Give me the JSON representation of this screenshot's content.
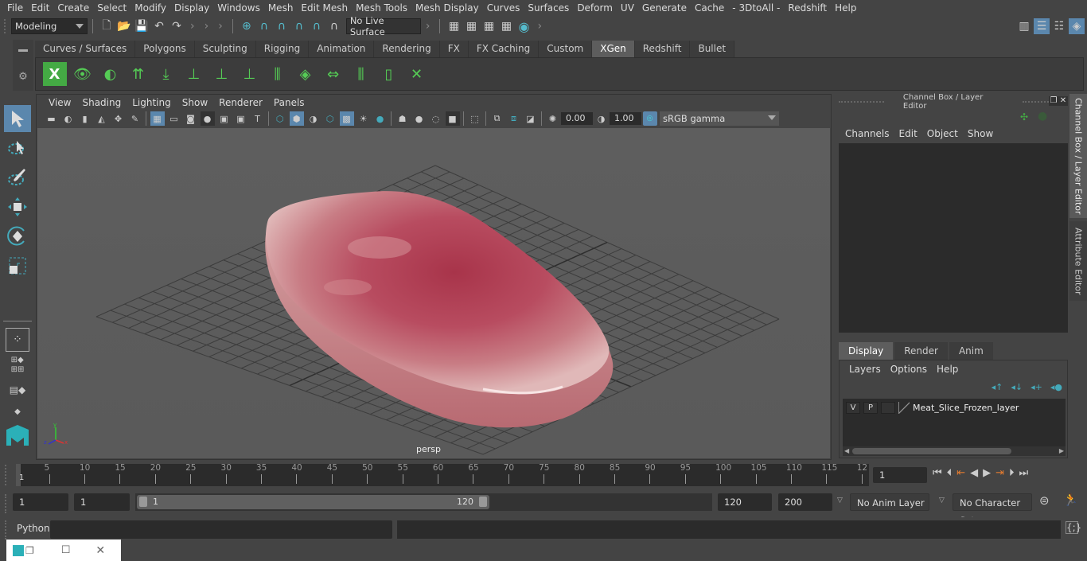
{
  "menubar": {
    "items": [
      "File",
      "Edit",
      "Create",
      "Select",
      "Modify",
      "Display",
      "Windows",
      "Mesh",
      "Edit Mesh",
      "Mesh Tools",
      "Mesh Display",
      "Curves",
      "Surfaces",
      "Deform",
      "UV",
      "Generate",
      "Cache",
      "- 3DtoAll -",
      "Redshift",
      "Help"
    ]
  },
  "statusline": {
    "mode": "Modeling",
    "live_surface": "No Live Surface"
  },
  "shelf": {
    "tabs": [
      "Curves / Surfaces",
      "Polygons",
      "Sculpting",
      "Rigging",
      "Animation",
      "Rendering",
      "FX",
      "FX Caching",
      "Custom",
      "XGen",
      "Redshift",
      "Bullet"
    ],
    "active_tab": "XGen",
    "icons": [
      "xgen-description-editor-icon",
      "xgen-preview-icon",
      "xgen-hide-icon",
      "xgen-add-guides-icon",
      "xgen-place-guides-icon",
      "xgen-add-guide-icon",
      "xgen-show-guides-icon",
      "xgen-lock-guides-icon",
      "xgen-guide-split-icon",
      "xgen-patch-icon",
      "xgen-length-icon",
      "xgen-select-guides-icon",
      "xgen-bounding-icon",
      "xgen-delete-guides-icon"
    ]
  },
  "viewport": {
    "menus": [
      "View",
      "Shading",
      "Lighting",
      "Show",
      "Renderer",
      "Panels"
    ],
    "exposure": "0.00",
    "gamma": "1.00",
    "colorspace": "sRGB gamma",
    "camera_label": "persp",
    "colors": {
      "meat_dark": "#a02840",
      "meat_light": "#e8c0c0",
      "grid": "#3a3a3a",
      "bg": "#5d5d5d"
    }
  },
  "channelbox": {
    "title": "Channel Box / Layer Editor",
    "menus": [
      "Channels",
      "Edit",
      "Object",
      "Show"
    ],
    "layer_tabs": [
      "Display",
      "Render",
      "Anim"
    ],
    "active_layer_tab": "Display",
    "layer_menus": [
      "Layers",
      "Options",
      "Help"
    ],
    "layer": {
      "v": "V",
      "p": "P",
      "name": "Meat_Slice_Frozen_layer"
    }
  },
  "sidetabs": [
    "Channel Box / Layer Editor",
    "Attribute Editor"
  ],
  "timeline": {
    "ticks": [
      "5",
      "10",
      "15",
      "20",
      "25",
      "30",
      "35",
      "40",
      "45",
      "50",
      "55",
      "60",
      "65",
      "70",
      "75",
      "80",
      "85",
      "90",
      "95",
      "100",
      "105",
      "110",
      "115",
      "12"
    ],
    "current_frame_marker": "1",
    "current_frame": "1"
  },
  "range": {
    "start": "1",
    "playback_start": "1",
    "slider_start": "1",
    "slider_end": "120",
    "playback_end": "120",
    "end": "200",
    "anim_layer": "No Anim Layer",
    "character_set": "No Character Set"
  },
  "cmdline": {
    "label": "Python"
  }
}
